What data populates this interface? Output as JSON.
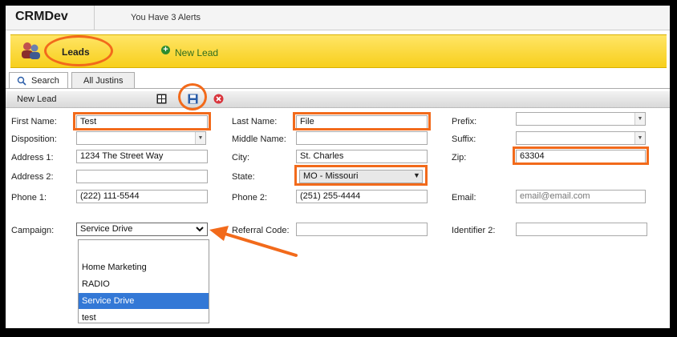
{
  "app": {
    "title": "CRMDev",
    "alerts": "You Have 3 Alerts"
  },
  "band": {
    "title": "Leads",
    "new_lead": "New Lead"
  },
  "tabs": [
    {
      "label": "Search"
    },
    {
      "label": "All Justins"
    }
  ],
  "toolbar": {
    "label": "New Lead"
  },
  "form": {
    "first_name": {
      "label": "First Name:",
      "value": "Test"
    },
    "last_name": {
      "label": "Last Name:",
      "value": "File"
    },
    "prefix": {
      "label": "Prefix:",
      "value": ""
    },
    "disposition": {
      "label": "Disposition:",
      "value": ""
    },
    "middle_name": {
      "label": "Middle Name:",
      "value": ""
    },
    "suffix": {
      "label": "Suffix:",
      "value": ""
    },
    "address1": {
      "label": "Address 1:",
      "value": "1234 The Street Way"
    },
    "city": {
      "label": "City:",
      "value": "St. Charles"
    },
    "zip": {
      "label": "Zip:",
      "value": "63304"
    },
    "address2": {
      "label": "Address 2:",
      "value": ""
    },
    "state": {
      "label": "State:",
      "value": "MO - Missouri"
    },
    "phone1": {
      "label": "Phone 1:",
      "value": "(222) 111-5544"
    },
    "phone2": {
      "label": "Phone 2:",
      "value": "(251) 255-4444"
    },
    "email": {
      "label": "Email:",
      "placeholder": "email@email.com"
    },
    "campaign": {
      "label": "Campaign:",
      "value": "Service Drive",
      "options": [
        "",
        "Home Marketing",
        "RADIO",
        "Service Drive",
        "test"
      ]
    },
    "referral_code": {
      "label": "Referral Code:",
      "value": ""
    },
    "identifier2": {
      "label": "Identifier 2:",
      "value": ""
    }
  },
  "colors": {
    "highlight": "#f26a1b",
    "band": "#f7cf1c",
    "selected_option": "#3378d6"
  }
}
